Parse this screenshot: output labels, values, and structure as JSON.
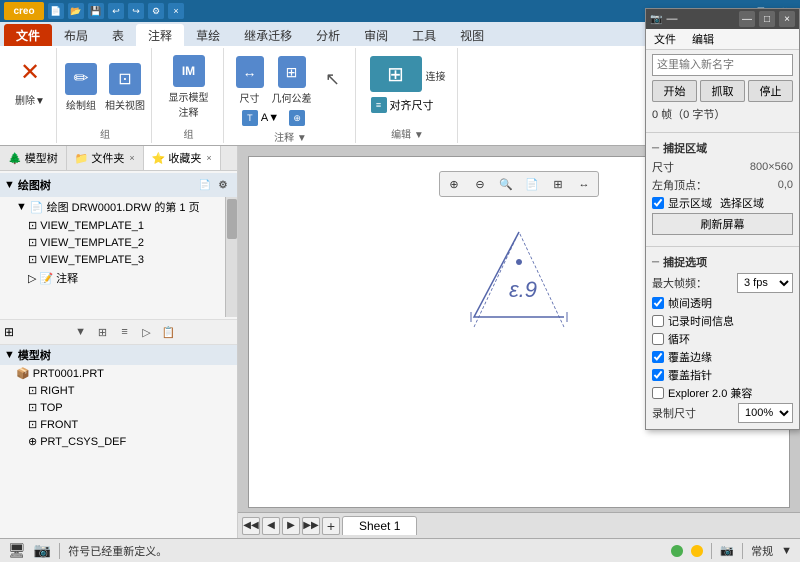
{
  "app": {
    "title": "creo",
    "logo": "creo"
  },
  "title_bar": {
    "controls": [
      "—",
      "□",
      "×"
    ]
  },
  "ribbon": {
    "tabs": [
      "文件",
      "布局",
      "表",
      "注释",
      "草绘",
      "继承迁移",
      "分析",
      "审阅",
      "工具",
      "视图"
    ],
    "active_tab": "注释",
    "groups": [
      {
        "label": "组",
        "buttons": [
          {
            "icon": "✏",
            "label": "绘制组"
          },
          {
            "icon": "👁",
            "label": "相关视图"
          }
        ]
      },
      {
        "label": "组",
        "buttons": [
          {
            "icon": "IM",
            "label": "显示模型\n注释"
          }
        ]
      },
      {
        "label": "注释",
        "buttons": [
          {
            "icon": "↔",
            "label": "尺寸"
          },
          {
            "icon": "±",
            "label": "几何公差"
          }
        ]
      },
      {
        "label": "编辑",
        "buttons": [
          {
            "icon": "⊞",
            "label": "连接"
          },
          {
            "icon": "≡",
            "label": "对齐尺寸"
          }
        ]
      }
    ],
    "delete_label": "删除▼"
  },
  "left_panel": {
    "tabs": [
      {
        "label": "模型树",
        "icon": "🌲",
        "active": false
      },
      {
        "label": "文件夹",
        "icon": "📁",
        "active": false
      },
      {
        "label": "收藏夹",
        "icon": "⭐",
        "active": true
      }
    ],
    "drawing_tree": {
      "header": "绘图树",
      "items": [
        {
          "label": "绘图 DRW0001.DRW 的第 1 页",
          "level": 0
        },
        {
          "label": "VIEW_TEMPLATE_1",
          "level": 1
        },
        {
          "label": "VIEW_TEMPLATE_2",
          "level": 1
        },
        {
          "label": "VIEW_TEMPLATE_3",
          "level": 1
        },
        {
          "label": "注释",
          "level": 0,
          "collapsed": true
        }
      ]
    },
    "model_tree": {
      "header": "模型树",
      "items": [
        {
          "label": "PRT0001.PRT",
          "level": 0
        },
        {
          "label": "RIGHT",
          "level": 1
        },
        {
          "label": "TOP",
          "level": 1
        },
        {
          "label": "FRONT",
          "level": 1
        },
        {
          "label": "PRT_CSYS_DEF",
          "level": 1
        }
      ]
    }
  },
  "drawing": {
    "toolbar_buttons": [
      "⊕",
      "⊖",
      "🔍",
      "📄",
      "⊞",
      "↔"
    ],
    "shape": "triangle"
  },
  "sheet": {
    "nav_buttons": [
      "◀◀",
      "◀",
      "▶",
      "▶▶"
    ],
    "add_button": "+",
    "tabs": [
      {
        "label": "Sheet 1",
        "active": true
      }
    ]
  },
  "status_bar": {
    "icons": [
      "🖥",
      "📷"
    ],
    "text": "符号已经重新定义。",
    "dots": [
      "green",
      "yellow"
    ],
    "right": "常规"
  },
  "floating_panel": {
    "title": "捕捉选项",
    "title_icon": "📷",
    "controls": [
      "—",
      "□",
      "×"
    ],
    "menu": [
      "文件",
      "编辑"
    ],
    "input_placeholder": "这里输入新名字",
    "buttons": [
      "开始",
      "抓取",
      "停止"
    ],
    "info_text": "0 帧（0 字节）",
    "sections": [
      {
        "title": "捕捉区域",
        "rows": [
          {
            "label": "尺寸",
            "value": "800×560"
          },
          {
            "label": "左角顶点：",
            "value": "0,0"
          }
        ],
        "checkboxes": [
          {
            "label": "显示区域",
            "checked": true
          },
          {
            "label": "选择区域",
            "checked": false
          }
        ]
      }
    ],
    "refresh_btn": "刷新屏幕",
    "capture_options": {
      "title": "捕捉选项",
      "max_fps_label": "最大帧频：",
      "max_fps_value": "3 fps",
      "checkboxes": [
        {
          "label": "帧间透明",
          "checked": true
        },
        {
          "label": "记录时间信息",
          "checked": false
        },
        {
          "label": "循环",
          "checked": false
        },
        {
          "label": "覆盖边缘",
          "checked": true
        },
        {
          "label": "覆盖指针",
          "checked": true
        },
        {
          "label": "Explorer 2.0 兼容",
          "checked": false
        }
      ],
      "record_size_label": "录制尺寸",
      "record_size_value": "100%"
    }
  }
}
